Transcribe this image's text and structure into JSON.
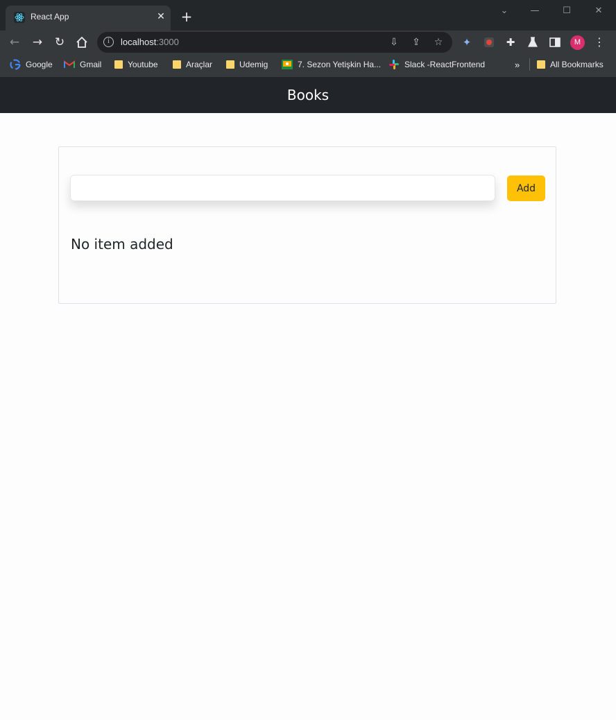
{
  "browser": {
    "tab_title": "React App",
    "url_host": "localhost",
    "url_port": ":3000",
    "avatar_initial": "M",
    "bookmarks": [
      {
        "label": "Google",
        "icon": "google-icon"
      },
      {
        "label": "Gmail",
        "icon": "gmail-icon"
      },
      {
        "label": "Youtube",
        "icon": "folder-icon"
      },
      {
        "label": "Araçlar",
        "icon": "folder-icon"
      },
      {
        "label": "Udemig",
        "icon": "folder-icon"
      },
      {
        "label": "7. Sezon Yetişkin Ha...",
        "icon": "classroom-icon"
      },
      {
        "label": "Slack -ReactFrontend",
        "icon": "slack-icon"
      }
    ],
    "overflow_label": "»",
    "all_bookmarks_label": "All Bookmarks"
  },
  "app": {
    "header_title": "Books",
    "input": {
      "value": "",
      "placeholder": ""
    },
    "add_button_label": "Add",
    "empty_message": "No item added"
  },
  "colors": {
    "header_bg": "#212529",
    "button_accent": "#ffc107",
    "avatar": "#d9306b"
  }
}
